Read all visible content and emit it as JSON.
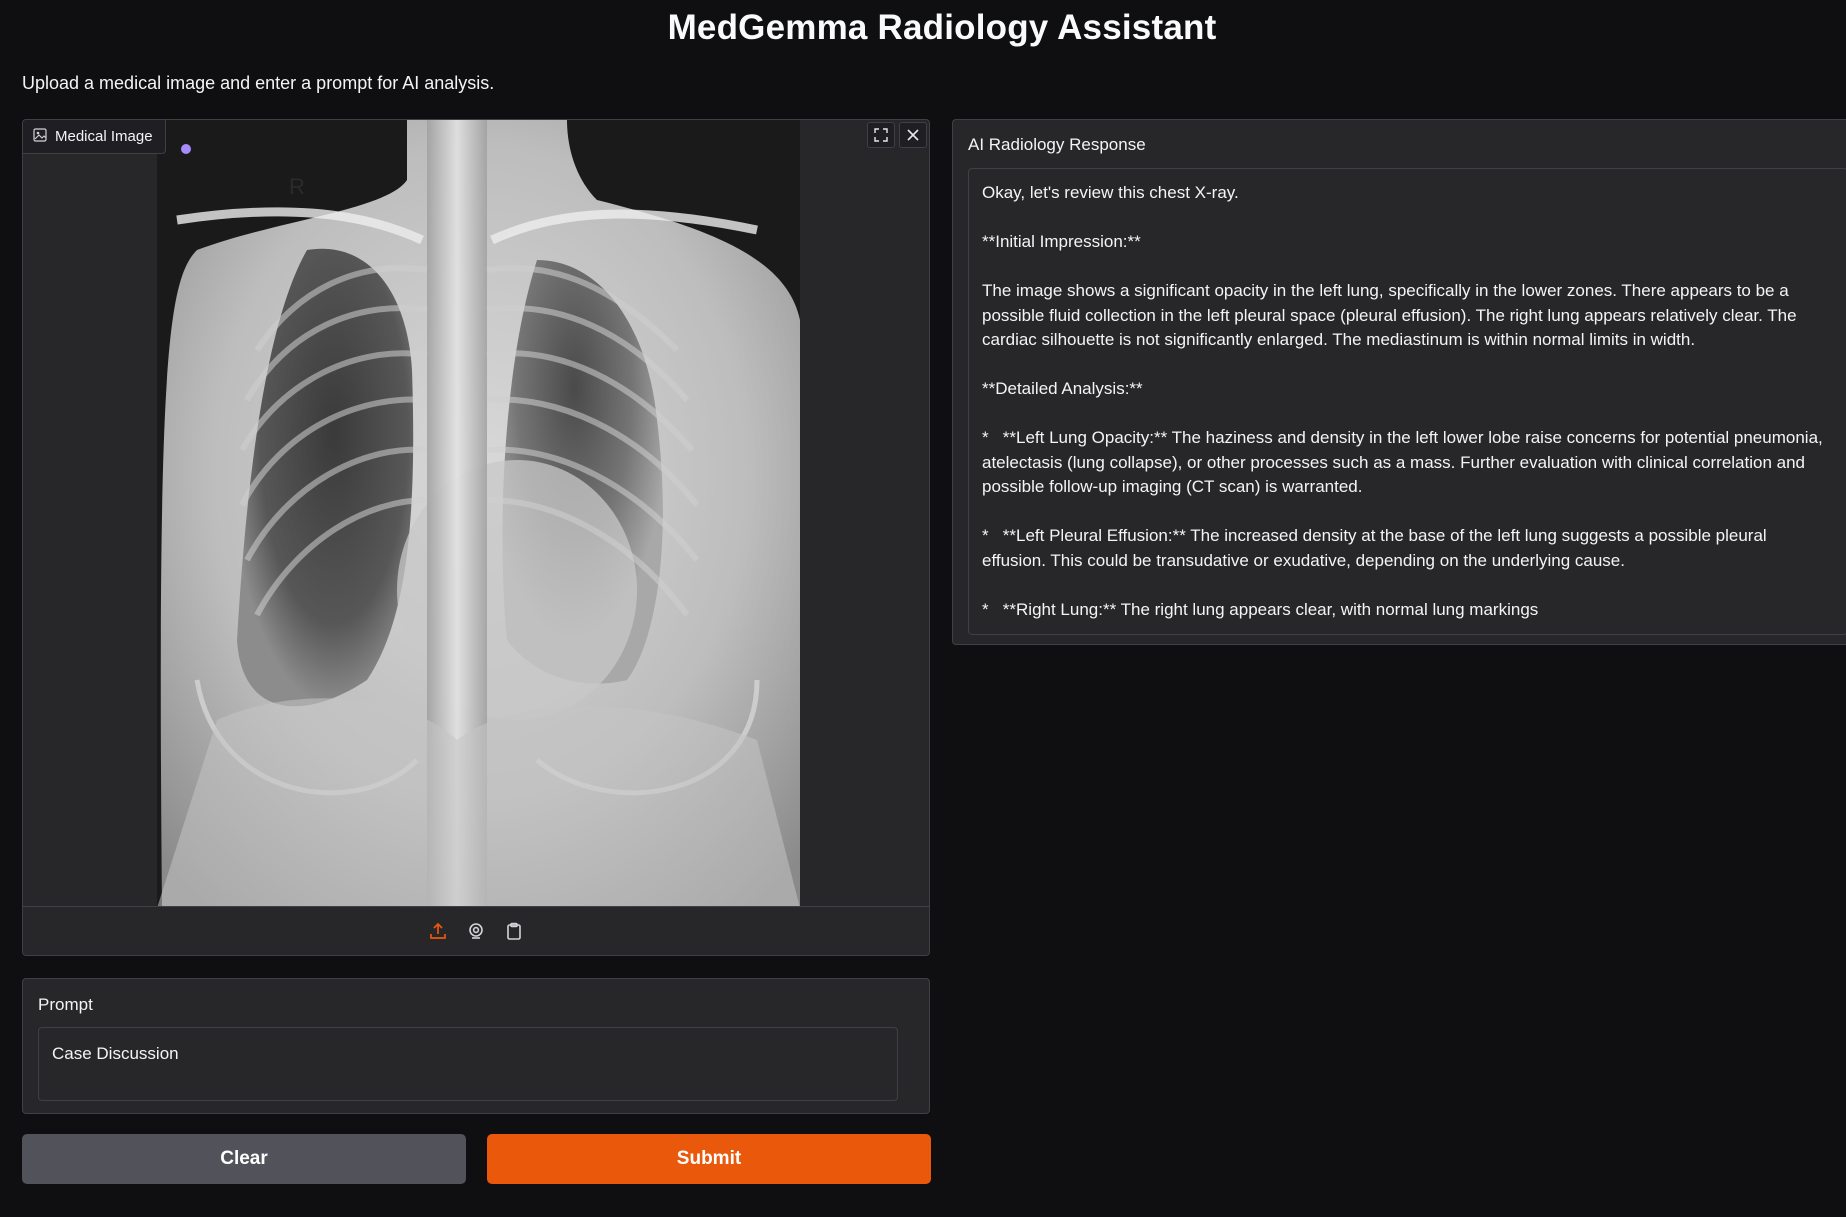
{
  "app": {
    "title": "MedGemma Radiology Assistant",
    "subtitle": "Upload a medical image and enter a prompt for AI analysis."
  },
  "image_input": {
    "label": "Medical Image",
    "toolbar": {
      "fullscreen_icon": "fullscreen-icon",
      "clear_icon": "close-icon"
    },
    "sources": [
      "upload-icon",
      "webcam-icon",
      "clipboard-icon"
    ],
    "image_marker_text": "R"
  },
  "prompt": {
    "label": "Prompt",
    "value": "Case Discussion"
  },
  "buttons": {
    "clear": "Clear",
    "submit": "Submit"
  },
  "response": {
    "label": "AI Radiology Response",
    "text": "Okay, let's review this chest X-ray.\n\n**Initial Impression:**\n\nThe image shows a significant opacity in the left lung, specifically in the lower zones. There appears to be a possible fluid collection in the left pleural space (pleural effusion). The right lung appears relatively clear. The cardiac silhouette is not significantly enlarged. The mediastinum is within normal limits in width.\n\n**Detailed Analysis:**\n\n*   **Left Lung Opacity:** The haziness and density in the left lower lobe raise concerns for potential pneumonia, atelectasis (lung collapse), or other processes such as a mass. Further evaluation with clinical correlation and possible follow-up imaging (CT scan) is warranted.\n\n*   **Left Pleural Effusion:** The increased density at the base of the left lung suggests a possible pleural effusion. This could be transudative or exudative, depending on the underlying cause.\n\n*   **Right Lung:** The right lung appears clear, with normal lung markings"
  },
  "colors": {
    "background": "#0f0f11",
    "panel": "#27272a",
    "border": "#3f3f46",
    "accent": "#ea580c",
    "secondary_button": "#52525b"
  }
}
